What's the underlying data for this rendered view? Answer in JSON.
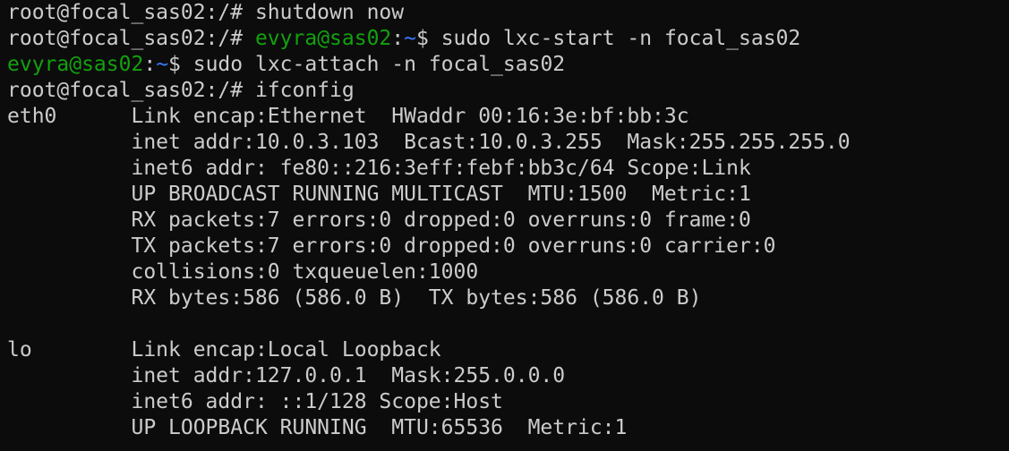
{
  "colors": {
    "background": "#0c0c0c",
    "default_text": "#cccccc",
    "user_host": "#13a10e",
    "path_tilde": "#3b78ff"
  },
  "terminal": {
    "lines": [
      [
        {
          "text": "root@focal_sas02:/# shutdown now",
          "color": "default"
        }
      ],
      [
        {
          "text": "root@focal_sas02:/# ",
          "color": "default"
        },
        {
          "text": "evyra@sas02",
          "color": "green"
        },
        {
          "text": ":",
          "color": "default"
        },
        {
          "text": "~",
          "color": "blue"
        },
        {
          "text": "$ sudo lxc-start -n focal_sas02",
          "color": "default"
        }
      ],
      [
        {
          "text": "evyra@sas02",
          "color": "green"
        },
        {
          "text": ":",
          "color": "default"
        },
        {
          "text": "~",
          "color": "blue"
        },
        {
          "text": "$ sudo lxc-attach -n focal_sas02",
          "color": "default"
        }
      ],
      [
        {
          "text": "root@focal_sas02:/# ifconfig",
          "color": "default"
        }
      ],
      [
        {
          "text": "eth0      Link encap:Ethernet  HWaddr 00:16:3e:bf:bb:3c",
          "color": "default"
        }
      ],
      [
        {
          "text": "          inet addr:10.0.3.103  Bcast:10.0.3.255  Mask:255.255.255.0",
          "color": "default"
        }
      ],
      [
        {
          "text": "          inet6 addr: fe80::216:3eff:febf:bb3c/64 Scope:Link",
          "color": "default"
        }
      ],
      [
        {
          "text": "          UP BROADCAST RUNNING MULTICAST  MTU:1500  Metric:1",
          "color": "default"
        }
      ],
      [
        {
          "text": "          RX packets:7 errors:0 dropped:0 overruns:0 frame:0",
          "color": "default"
        }
      ],
      [
        {
          "text": "          TX packets:7 errors:0 dropped:0 overruns:0 carrier:0",
          "color": "default"
        }
      ],
      [
        {
          "text": "          collisions:0 txqueuelen:1000",
          "color": "default"
        }
      ],
      [
        {
          "text": "          RX bytes:586 (586.0 B)  TX bytes:586 (586.0 B)",
          "color": "default"
        }
      ],
      [
        {
          "text": "",
          "color": "default"
        }
      ],
      [
        {
          "text": "lo        Link encap:Local Loopback",
          "color": "default"
        }
      ],
      [
        {
          "text": "          inet addr:127.0.0.1  Mask:255.0.0.0",
          "color": "default"
        }
      ],
      [
        {
          "text": "          inet6 addr: ::1/128 Scope:Host",
          "color": "default"
        }
      ],
      [
        {
          "text": "          UP LOOPBACK RUNNING  MTU:65536  Metric:1",
          "color": "default"
        }
      ]
    ]
  }
}
